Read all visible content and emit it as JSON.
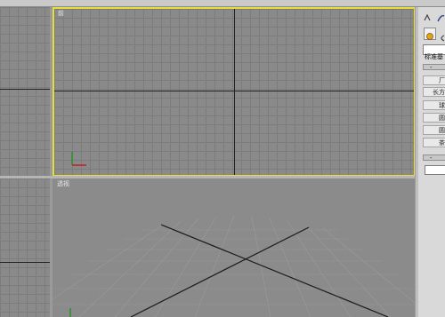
{
  "viewports": {
    "top_left_label": "前",
    "perspective_label": "透视"
  },
  "command_panel": {
    "dropdown_value": "标准基",
    "rollout_symbol": "-",
    "rollout_symbol_2": "-",
    "buttons": [
      "厂",
      "长方",
      "球",
      "圆",
      "圆",
      "茶"
    ]
  },
  "colors": {
    "active_border": "#e6df37",
    "axis_y": "#2f8f2f",
    "axis_x": "#c02020"
  }
}
